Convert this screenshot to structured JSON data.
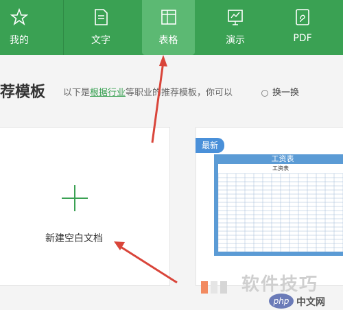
{
  "tabs": [
    {
      "label": "我的",
      "icon": "star-icon"
    },
    {
      "label": "文字",
      "icon": "document-icon"
    },
    {
      "label": "表格",
      "icon": "table-icon"
    },
    {
      "label": "演示",
      "icon": "presentation-icon"
    },
    {
      "label": "PDF",
      "icon": "pdf-icon"
    }
  ],
  "active_tab": "表格",
  "section": {
    "title": "荐模板",
    "desc_prefix": "以下是",
    "desc_link": "根据行业",
    "desc_suffix": "等职业的推荐模板，你可以",
    "refresh_label": "换一换"
  },
  "new_blank": {
    "label": "新建空白文档"
  },
  "template": {
    "badge": "最新",
    "sheet_header": "工资表",
    "sheet_title": "工资表"
  },
  "watermark": {
    "text": "软件技巧",
    "logo": "php",
    "site": "中文网"
  },
  "colors": {
    "brand_green": "#3aa153",
    "badge_blue": "#4a90d9",
    "arrow_red": "#d9453a"
  }
}
